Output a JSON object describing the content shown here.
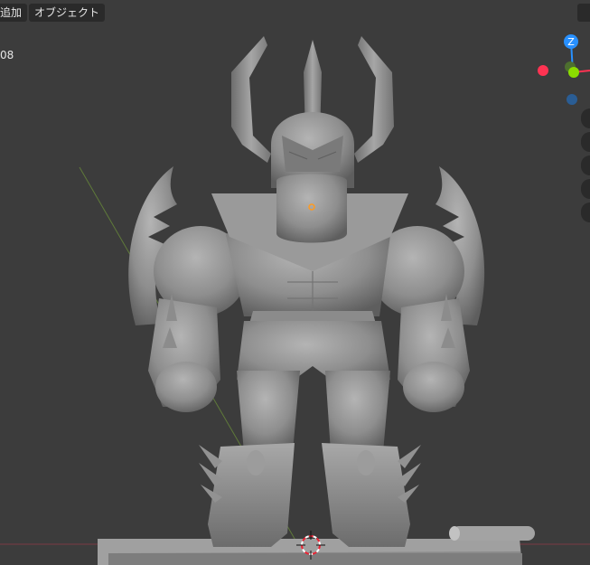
{
  "header": {
    "add_menu_label": "追加",
    "object_menu_label": "オブジェクト"
  },
  "overlay": {
    "stat_fragment": "08"
  },
  "gizmo": {
    "z_label": "Z"
  },
  "colors": {
    "viewport_bg": "#3c3c3c",
    "x_axis": "#ff3352",
    "y_axis": "#8bdc00",
    "z_axis": "#2890ff",
    "neg_z_axis": "#2a5d94",
    "model_gray": "#8f8f8f",
    "origin_dot": "#ff9a1f"
  }
}
